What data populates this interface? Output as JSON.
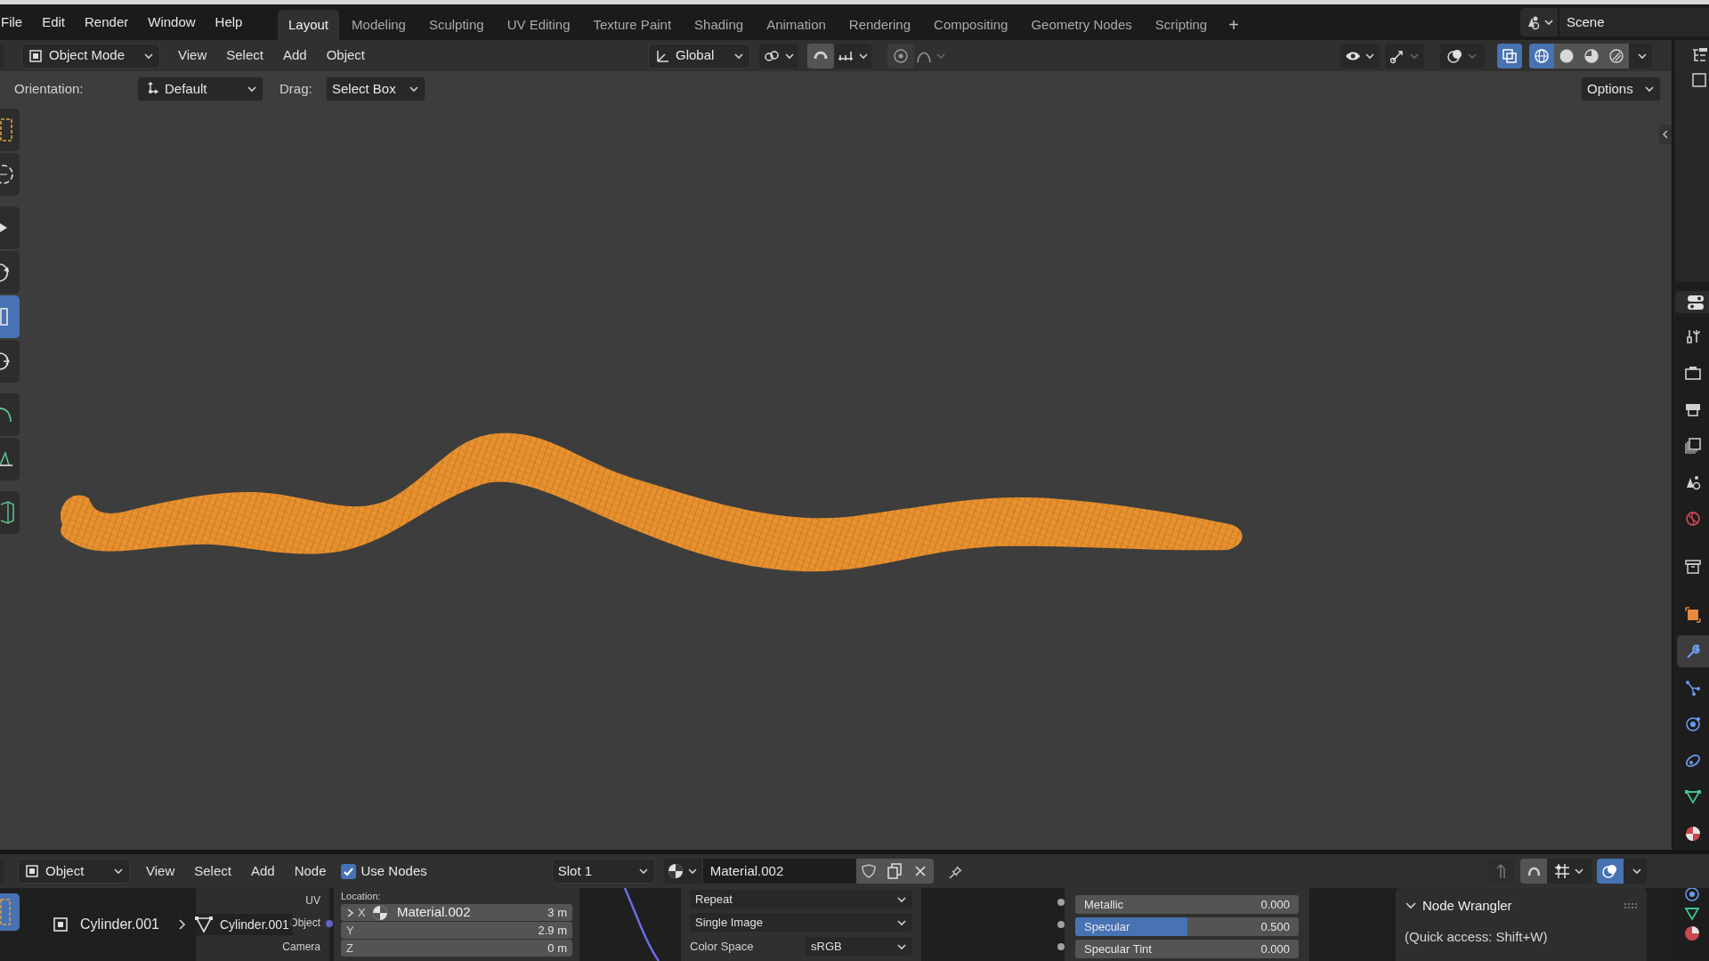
{
  "menu_bar": {
    "menus": [
      "File",
      "Edit",
      "Render",
      "Window",
      "Help"
    ],
    "workspaces": [
      {
        "label": "Layout",
        "selected": true
      },
      {
        "label": "Modeling",
        "selected": false
      },
      {
        "label": "Sculpting",
        "selected": false
      },
      {
        "label": "UV Editing",
        "selected": false
      },
      {
        "label": "Texture Paint",
        "selected": false
      },
      {
        "label": "Shading",
        "selected": false
      },
      {
        "label": "Animation",
        "selected": false
      },
      {
        "label": "Rendering",
        "selected": false
      },
      {
        "label": "Compositing",
        "selected": false
      },
      {
        "label": "Geometry Nodes",
        "selected": false
      },
      {
        "label": "Scripting",
        "selected": false
      }
    ],
    "add_workspace": "+",
    "scene": "Scene"
  },
  "viewport_header": {
    "mode": "Object Mode",
    "menus": [
      "View",
      "Select",
      "Add",
      "Object"
    ],
    "transform_orientation": "Global",
    "shading_modes": [
      {
        "kind": "wireframe",
        "selected": true
      },
      {
        "kind": "solid",
        "selected": false
      },
      {
        "kind": "material",
        "selected": false
      },
      {
        "kind": "rendered",
        "selected": false
      }
    ]
  },
  "tool_settings": {
    "orientation_label": "Orientation:",
    "orientation": "Default",
    "drag_label": "Drag:",
    "drag": "Select Box",
    "options": "Options"
  },
  "toolbar": [
    {
      "kind": "select",
      "selected": false
    },
    {
      "kind": "cursor",
      "selected": false
    },
    {
      "kind": "move",
      "selected": false
    },
    {
      "kind": "rotate",
      "selected": false
    },
    {
      "kind": "scale",
      "selected": true
    },
    {
      "kind": "transform",
      "selected": false
    },
    {
      "kind": "annotate",
      "selected": false
    },
    {
      "kind": "measure",
      "selected": false
    },
    {
      "kind": "add_cube",
      "selected": false
    }
  ],
  "properties_tabs": [
    {
      "kind": "tool",
      "selected": false
    },
    {
      "kind": "render",
      "selected": false
    },
    {
      "kind": "output",
      "selected": false
    },
    {
      "kind": "view_layer",
      "selected": false
    },
    {
      "kind": "scene",
      "selected": false
    },
    {
      "kind": "world",
      "selected": false
    },
    {
      "kind": "collection",
      "selected": false
    },
    {
      "kind": "object",
      "selected": false
    },
    {
      "kind": "modifiers",
      "selected": true
    },
    {
      "kind": "particles",
      "selected": false
    },
    {
      "kind": "physics",
      "selected": false
    },
    {
      "kind": "constraints",
      "selected": false
    },
    {
      "kind": "data",
      "selected": false
    },
    {
      "kind": "material",
      "selected": false
    }
  ],
  "node_editor": {
    "type": "Object",
    "menus": [
      "View",
      "Select",
      "Add",
      "Node"
    ],
    "use_nodes": {
      "label": "Use Nodes",
      "checked": true
    },
    "slot": "Slot 1",
    "material": "Material.002",
    "breadcrumbs": [
      "Cylinder.001",
      "Cylinder.001"
    ],
    "texture_coordinate_outputs": [
      "UV",
      "Object",
      "Camera"
    ],
    "mapping": {
      "location_label": "Location:",
      "rows": [
        {
          "axis": "X",
          "value": "3 m"
        },
        {
          "axis": "Y",
          "value": "2.9 m"
        },
        {
          "axis": "Z",
          "value": "0 m"
        }
      ],
      "material_popup": "Material.002"
    },
    "image_texture": {
      "extension": "Repeat",
      "source": "Single Image",
      "color_space_label": "Color Space",
      "color_space": "sRGB"
    },
    "principled": [
      {
        "label": "Metallic",
        "value": "0.000",
        "level": 0
      },
      {
        "label": "Specular",
        "value": "0.500",
        "level": 0.5
      },
      {
        "label": "Specular Tint",
        "value": "0.000",
        "level": 0
      }
    ],
    "sidebar": {
      "panel": "Node Wrangler",
      "expanded": true,
      "text": "(Quick access: Shift+W)"
    }
  }
}
